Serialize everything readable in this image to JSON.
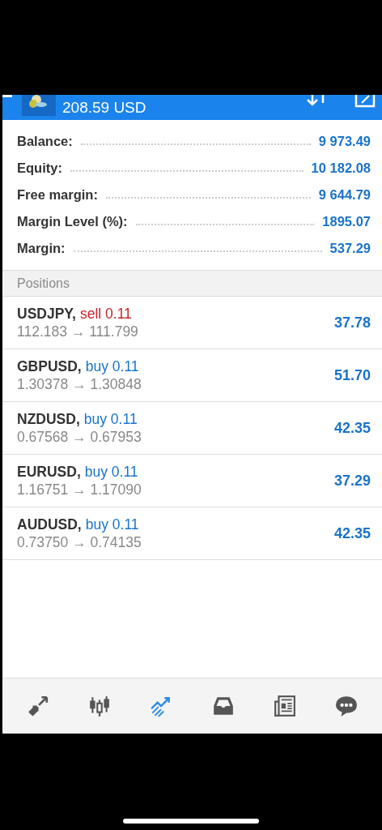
{
  "header": {
    "balance": "208.59 USD"
  },
  "summary": [
    {
      "label": "Balance:",
      "value": "9 973.49"
    },
    {
      "label": "Equity:",
      "value": "10 182.08"
    },
    {
      "label": "Free margin:",
      "value": "9 644.79"
    },
    {
      "label": "Margin Level (%):",
      "value": "1895.07"
    },
    {
      "label": "Margin:",
      "value": "537.29"
    }
  ],
  "positions": {
    "title": "Positions",
    "rows": [
      {
        "symbol": "USDJPY,",
        "kind": "sell",
        "order": "sell 0.11",
        "prices": "112.183 → 111.799",
        "profit": "37.78"
      },
      {
        "symbol": "GBPUSD,",
        "kind": "buy",
        "order": "buy 0.11",
        "prices": "1.30378 → 1.30848",
        "profit": "51.70"
      },
      {
        "symbol": "NZDUSD,",
        "kind": "buy",
        "order": "buy 0.11",
        "prices": "0.67568 → 0.67953",
        "profit": "42.35"
      },
      {
        "symbol": "EURUSD,",
        "kind": "buy",
        "order": "buy 0.11",
        "prices": "1.16751 → 1.17090",
        "profit": "37.29"
      },
      {
        "symbol": "AUDUSD,",
        "kind": "buy",
        "order": "buy 0.11",
        "prices": "0.73750 → 0.74135",
        "profit": "42.35"
      }
    ]
  },
  "nav": [
    {
      "kind": "arrows",
      "selected": false
    },
    {
      "kind": "candles",
      "selected": false
    },
    {
      "kind": "trend",
      "selected": true
    },
    {
      "kind": "inbox",
      "selected": false
    },
    {
      "kind": "news",
      "selected": false
    },
    {
      "kind": "chat",
      "selected": false
    }
  ]
}
